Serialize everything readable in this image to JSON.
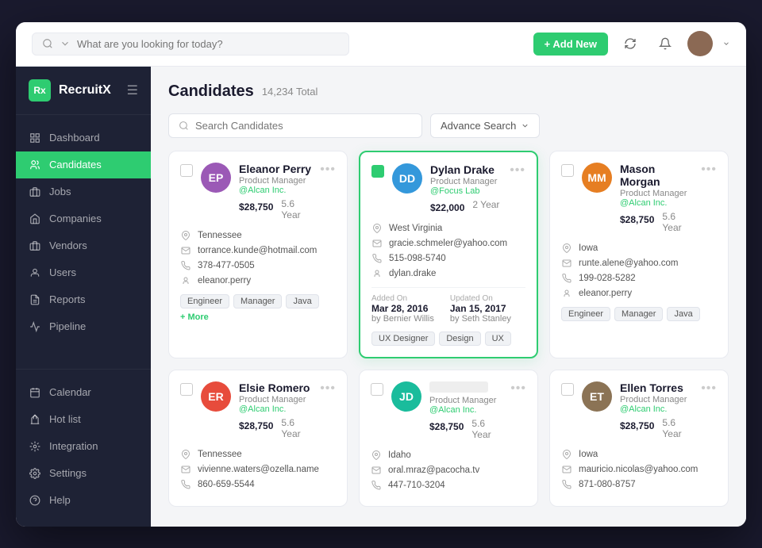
{
  "app": {
    "logo_text": "Rx",
    "app_name": "RecruitX",
    "menu_icon": "☰"
  },
  "header": {
    "search_placeholder": "What are you looking for today?",
    "add_btn_label": "+ Add New"
  },
  "sidebar": {
    "items": [
      {
        "id": "dashboard",
        "label": "Dashboard",
        "icon": "dashboard"
      },
      {
        "id": "candidates",
        "label": "Candidates",
        "icon": "candidates",
        "active": true
      },
      {
        "id": "jobs",
        "label": "Jobs",
        "icon": "jobs"
      },
      {
        "id": "companies",
        "label": "Companies",
        "icon": "companies"
      },
      {
        "id": "vendors",
        "label": "Vendors",
        "icon": "vendors"
      },
      {
        "id": "users",
        "label": "Users",
        "icon": "users"
      },
      {
        "id": "reports",
        "label": "Reports",
        "icon": "reports"
      },
      {
        "id": "pipeline",
        "label": "Pipeline",
        "icon": "pipeline"
      }
    ],
    "bottom_items": [
      {
        "id": "calendar",
        "label": "Calendar",
        "icon": "calendar"
      },
      {
        "id": "hotlist",
        "label": "Hot list",
        "icon": "hotlist"
      },
      {
        "id": "integration",
        "label": "Integration",
        "icon": "integration"
      },
      {
        "id": "settings",
        "label": "Settings",
        "icon": "settings"
      },
      {
        "id": "help",
        "label": "Help",
        "icon": "help"
      }
    ]
  },
  "page": {
    "title": "Candidates",
    "total": "14,234 Total",
    "search_placeholder": "Search Candidates",
    "advance_search": "Advance Search"
  },
  "candidates": [
    {
      "id": 1,
      "name": "Eleanor Perry",
      "company": "@Alcan Inc.",
      "salary": "$28,750",
      "experience": "5.6 Year",
      "location": "Tennessee",
      "email": "torrance.kunde@hotmail.com",
      "phone": "378-477-0505",
      "username": "eleanor.perry",
      "tags": [
        "Engineer",
        "Manager",
        "Java",
        "+ More"
      ],
      "selected": false,
      "avatar_color": "purple",
      "initials": "EP"
    },
    {
      "id": 2,
      "name": "Dylan Drake",
      "company": "@Focus Lab",
      "salary": "$22,000",
      "experience": "2 Year",
      "location": "West Virginia",
      "email": "gracie.schmeler@yahoo.com",
      "phone": "515-098-5740",
      "username": "dylan.drake",
      "tags": [
        "UX Designer",
        "Design",
        "UX"
      ],
      "selected": true,
      "added_on": "Mar 28, 2016",
      "added_by": "Bernier Willis",
      "updated_on": "Jan 15, 2017",
      "updated_by": "Seth Stanley",
      "avatar_color": "blue",
      "initials": "DD"
    },
    {
      "id": 3,
      "name": "Mason Morgan",
      "company": "@Alcan Inc.",
      "salary": "$28,750",
      "experience": "5.6 Year",
      "location": "Iowa",
      "email": "runte.alene@yahoo.com",
      "phone": "199-028-5282",
      "username": "eleanor.perry",
      "tags": [
        "Engineer",
        "Manager",
        "Java"
      ],
      "selected": false,
      "avatar_color": "orange",
      "initials": "MM"
    },
    {
      "id": 4,
      "name": "Elsie Romero",
      "company": "@Alcan Inc.",
      "salary": "$28,750",
      "experience": "5.6 Year",
      "location": "Tennessee",
      "email": "vivienne.waters@ozella.name",
      "phone": "860-659-5544",
      "username": "",
      "tags": [],
      "selected": false,
      "avatar_color": "red",
      "initials": "ER"
    },
    {
      "id": 5,
      "name": "",
      "company": "@Alcan Inc.",
      "salary": "$28,750",
      "experience": "5.6 Year",
      "location": "Idaho",
      "email": "oral.mraz@pacocha.tv",
      "phone": "447-710-3204",
      "username": "",
      "tags": [],
      "selected": false,
      "avatar_color": "teal",
      "initials": "JD"
    },
    {
      "id": 6,
      "name": "Ellen Torres",
      "company": "@Alcan Inc.",
      "salary": "$28,750",
      "experience": "5.6 Year",
      "location": "Iowa",
      "email": "mauricio.nicolas@yahoo.com",
      "phone": "871-080-8757",
      "username": "",
      "tags": [],
      "selected": false,
      "avatar_color": "brown",
      "initials": "ET"
    }
  ]
}
